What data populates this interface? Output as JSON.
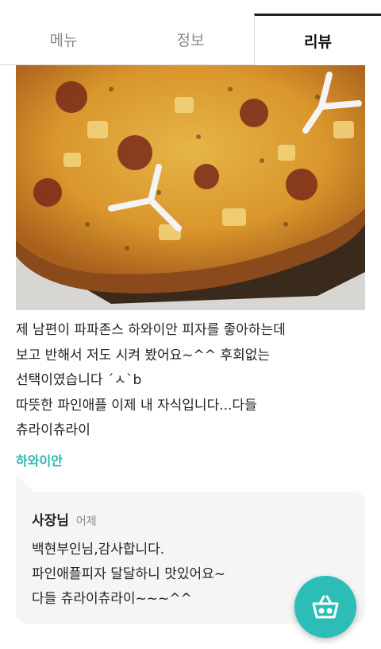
{
  "tabs": [
    {
      "label": "메뉴"
    },
    {
      "label": "정보"
    },
    {
      "label": "리뷰"
    }
  ],
  "review": {
    "lines": [
      "제 남편이 파파존스 하와이안 피자를 좋아하는데",
      "보고 반해서 저도 시켜 봤어요~^^ 후회없는",
      "선택이였습니다 ´ㅅ`b",
      "따뜻한 파인애플 이제 내 자식입니다...다들",
      "츄라이츄라이"
    ],
    "menu_tag": "하와이안"
  },
  "reply": {
    "author": "사장님",
    "time": "어제",
    "lines": [
      "백현부인님,감사합니다.",
      "파인애플피자 달달하니 맛있어요~",
      "다들 츄라이츄라이~~~^^"
    ]
  },
  "icons": {
    "cart": "shopping-basket-icon"
  },
  "colors": {
    "accent": "#2bbdb6",
    "tag": "#2bb7b0",
    "reply_bg": "#f5f5f5"
  }
}
